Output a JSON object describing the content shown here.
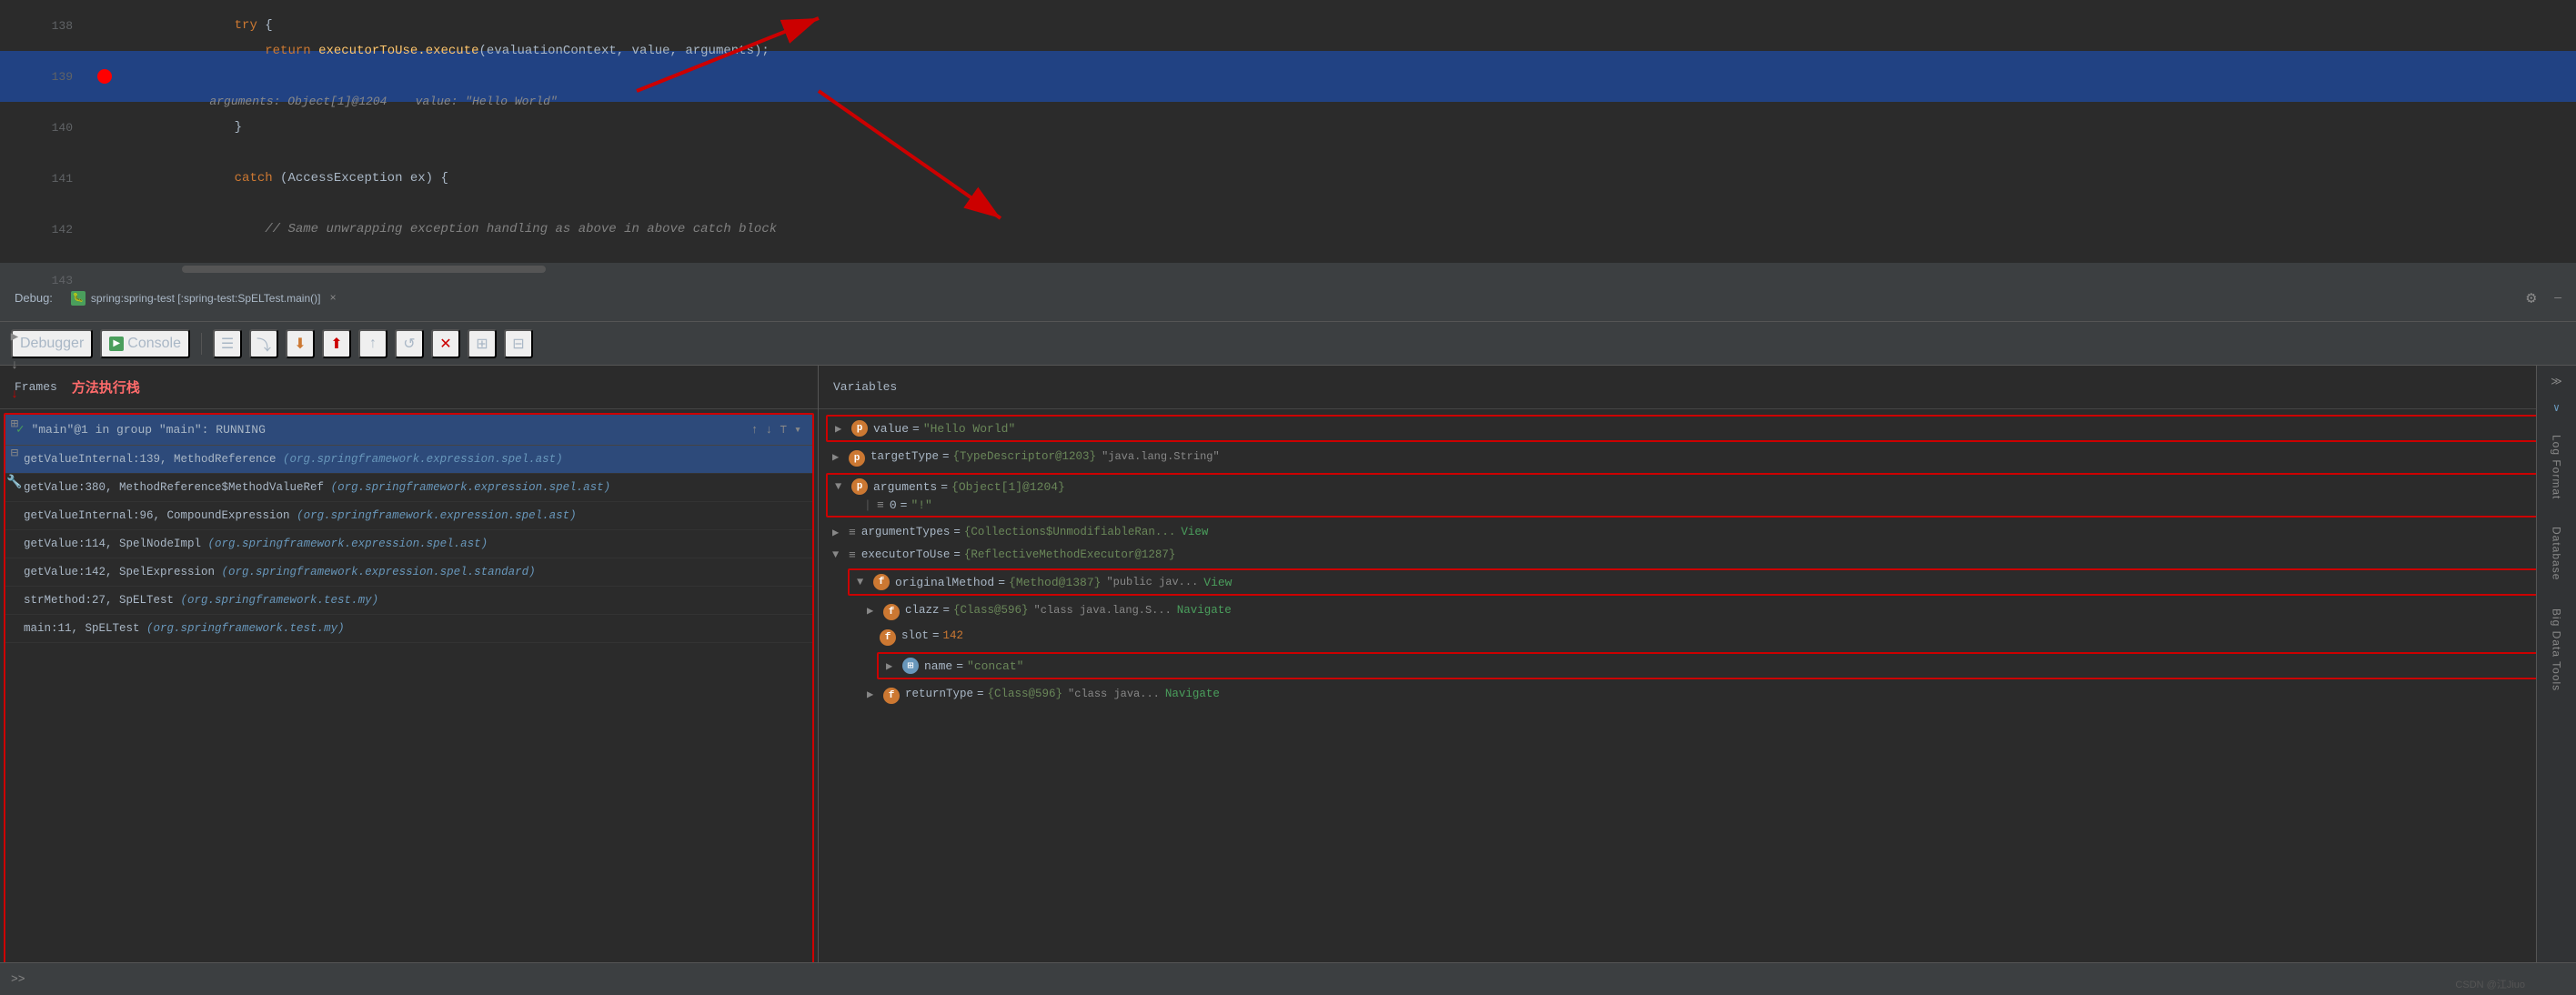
{
  "editor": {
    "lines": [
      {
        "number": "138",
        "indent": 2,
        "content": "try {",
        "keywords": [
          {
            "word": "try",
            "class": "kw"
          }
        ],
        "highlighted": false,
        "breakpoint": false,
        "arrow": false
      },
      {
        "number": "139",
        "indent": 3,
        "content": "return executorToUse.execute(evaluationContext, value, arguments);",
        "highlighted": true,
        "breakpoint": true,
        "arrow": false,
        "hint": "arguments: Object[1]@1204    value: \"Hello World\""
      },
      {
        "number": "140",
        "indent": 2,
        "content": "}",
        "highlighted": false,
        "breakpoint": false,
        "arrow": false
      },
      {
        "number": "141",
        "indent": 2,
        "content": "catch (AccessException ex) {",
        "highlighted": false,
        "breakpoint": false,
        "arrow": false
      },
      {
        "number": "142",
        "indent": 3,
        "content": "// Same unwrapping exception handling as above in above catch block",
        "highlighted": false,
        "breakpoint": false,
        "arrow": false,
        "comment": true
      },
      {
        "number": "143",
        "indent": 0,
        "content": "",
        "highlighted": false,
        "breakpoint": false,
        "arrow": false
      }
    ]
  },
  "debug_header": {
    "label": "Debug:",
    "tab_icon": "bug",
    "tab_label": "spring:spring-test [:spring-test:SpELTest.main()]",
    "close": "×",
    "gear_label": "⚙"
  },
  "toolbar": {
    "buttons": [
      {
        "name": "rerun",
        "icon": "↺",
        "label": "Rerun"
      },
      {
        "name": "resume",
        "icon": "▶",
        "label": "Resume"
      },
      {
        "name": "step-over",
        "icon": "⤵",
        "label": "Step Over"
      },
      {
        "name": "step-into",
        "icon": "⬇",
        "label": "Step Into"
      },
      {
        "name": "step-out",
        "icon": "⬆",
        "label": "Step Out"
      },
      {
        "name": "run-to-cursor",
        "icon": "⤏",
        "label": "Run to Cursor"
      },
      {
        "name": "evaluate",
        "icon": "⊞",
        "label": "Evaluate"
      }
    ],
    "debugger_tab": "Debugger",
    "console_tab": "Console"
  },
  "frames": {
    "label": "Frames",
    "label_cn": "方法执行栈",
    "thread": {
      "name": "\"main\"@1 in group \"main\": RUNNING"
    },
    "stack": [
      {
        "fn": "getValueInternal:139, MethodReference",
        "cls": "(org.springframework.expression.spel.ast)",
        "active": true
      },
      {
        "fn": "getValue:380, MethodReference$MethodValueRef",
        "cls": "(org.springframework.expression.spel.ast)"
      },
      {
        "fn": "getValueInternal:96, CompoundExpression",
        "cls": "(org.springframework.expression.spel.ast)"
      },
      {
        "fn": "getValue:114, SpelNodeImpl",
        "cls": "(org.springframework.expression.spel.ast)"
      },
      {
        "fn": "getValue:142, SpelExpression",
        "cls": "(org.springframework.expression.spel.standard)"
      },
      {
        "fn": "strMethod:27, SpELTest",
        "cls": "(org.springframework.test.my)"
      },
      {
        "fn": "main:11, SpELTest",
        "cls": "(org.springframework.test.my)"
      }
    ]
  },
  "variables": {
    "label": "Variables",
    "items": [
      {
        "id": "value",
        "expand": "▶",
        "icon": "p",
        "icon_type": "orange",
        "name": "value",
        "eq": "=",
        "val": "\"Hello World\"",
        "boxed": true,
        "indent": 0
      },
      {
        "id": "targetType",
        "expand": "▶",
        "icon": "p",
        "icon_type": "orange",
        "name": "targetType",
        "eq": "=",
        "val": "{TypeDescriptor@1203}",
        "extra": "\"java.lang.String\"",
        "indent": 0
      },
      {
        "id": "arguments",
        "expand": "▼",
        "icon": "p",
        "icon_type": "orange",
        "name": "arguments",
        "eq": "=",
        "val": "{Object[1]@1204}",
        "boxed": true,
        "indent": 0
      },
      {
        "id": "arguments-0",
        "expand": "≡",
        "icon": null,
        "name": "0",
        "eq": "=",
        "val": "\"!\"",
        "indent": 1
      },
      {
        "id": "argumentTypes",
        "expand": "▶",
        "icon": "≡",
        "icon_type": null,
        "name": "argumentTypes",
        "eq": "=",
        "val": "{Collections$UnmodifiableRan...",
        "link": "View",
        "indent": 0
      },
      {
        "id": "executorToUse",
        "expand": "▼",
        "icon": "≡",
        "icon_type": null,
        "name": "executorToUse",
        "eq": "=",
        "val": "{ReflectiveMethodExecutor@1287}",
        "indent": 0
      },
      {
        "id": "originalMethod",
        "expand": "▼",
        "icon": "f",
        "icon_type": "orange",
        "name": "originalMethod",
        "eq": "=",
        "val": "{Method@1387}",
        "extra": "\"public jav...",
        "link": "View",
        "indent": 1,
        "boxed": true
      },
      {
        "id": "clazz",
        "expand": "▶",
        "icon": "f",
        "icon_type": "orange",
        "name": "clazz",
        "eq": "=",
        "val": "{Class@596}",
        "extra": "\"class java.lang.S...",
        "link": "Navigate",
        "indent": 2
      },
      {
        "id": "slot",
        "expand": null,
        "icon": "f",
        "icon_type": "orange",
        "name": "slot",
        "eq": "=",
        "val": "142",
        "val_class": "orange",
        "indent": 2
      },
      {
        "id": "name",
        "expand": "▶",
        "icon": "⊞",
        "icon_type": "blue-f",
        "name": "name",
        "eq": "=",
        "val": "\"concat\"",
        "indent": 2,
        "boxed": true
      },
      {
        "id": "returnType",
        "expand": "▶",
        "icon": "f",
        "icon_type": "orange",
        "name": "returnType",
        "eq": "=",
        "val": "{Class@596}",
        "extra": "\"class java...",
        "link": "Navigate",
        "indent": 2
      }
    ]
  },
  "right_sidebar": {
    "panels": [
      {
        "name": "log-format",
        "label": "Log Format"
      },
      {
        "name": "database",
        "label": "Database"
      },
      {
        "name": "big-data-tools",
        "label": "Big Data Tools"
      }
    ]
  },
  "bottom_controls": {
    "expand_label": ">>",
    "extra": ""
  },
  "watermark": "CSDN @江Jiuo"
}
